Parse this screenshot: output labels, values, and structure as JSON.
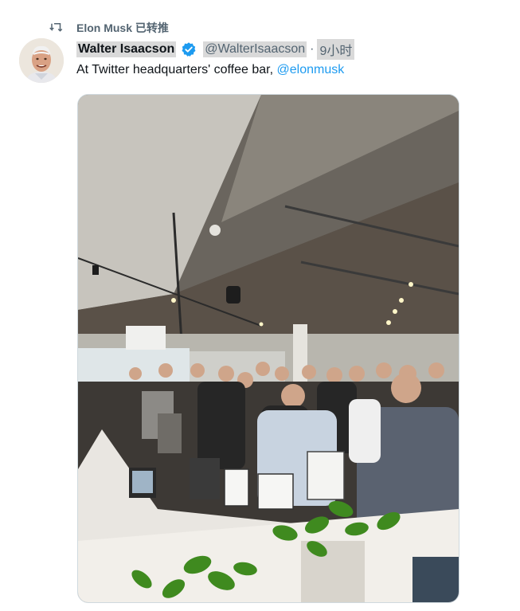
{
  "retweet": {
    "icon": "retweet-icon",
    "text": "Elon Musk 已转推"
  },
  "tweet": {
    "avatar_icon": "avatar",
    "display_name": "Walter Isaacson",
    "verified_icon": "verified-badge-icon",
    "verified_color": "#1d9bf0",
    "handle": "@WalterIsaacson",
    "separator": "·",
    "time": "9小时",
    "text": "At Twitter headquarters' coffee bar, ",
    "mention": "@elonmusk",
    "mention_color": "#1d9bf0"
  },
  "media": {
    "subject": "crowded office coffee bar with people standing around a counter"
  }
}
